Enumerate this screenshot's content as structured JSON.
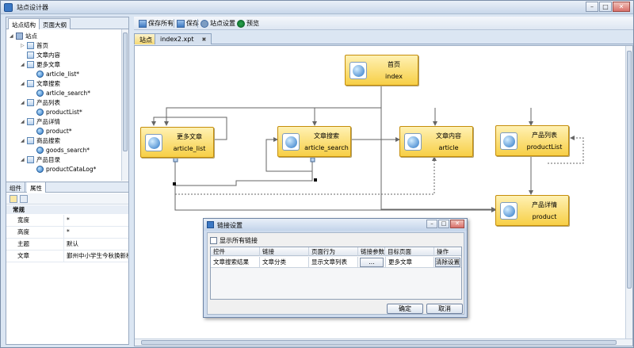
{
  "window": {
    "title": "站点设计器",
    "minimize": "–",
    "maximize": "□",
    "close": "✕"
  },
  "left_tabs": [
    "站点结构",
    "页面大纲"
  ],
  "tree": [
    {
      "label": "站点",
      "kind": "site",
      "toggle": "◢"
    },
    {
      "label": "首页",
      "kind": "folder",
      "toggle": "▷"
    },
    {
      "label": "文章内容",
      "kind": "folder",
      "toggle": ""
    },
    {
      "label": "更多文章",
      "kind": "folder",
      "toggle": "◢"
    },
    {
      "label": "article_list*",
      "kind": "page",
      "toggle": ""
    },
    {
      "label": "文章搜索",
      "kind": "folder",
      "toggle": "◢"
    },
    {
      "label": "article_search*",
      "kind": "page",
      "toggle": ""
    },
    {
      "label": "产品列表",
      "kind": "folder",
      "toggle": "◢"
    },
    {
      "label": "productList*",
      "kind": "page",
      "toggle": ""
    },
    {
      "label": "产品详情",
      "kind": "folder",
      "toggle": "◢"
    },
    {
      "label": "product*",
      "kind": "page",
      "toggle": ""
    },
    {
      "label": "商品搜索",
      "kind": "folder",
      "toggle": "◢"
    },
    {
      "label": "goods_search*",
      "kind": "page",
      "toggle": ""
    },
    {
      "label": "产品目录",
      "kind": "folder",
      "toggle": "◢"
    },
    {
      "label": "productCataLog*",
      "kind": "page",
      "toggle": ""
    }
  ],
  "prop_tabs": [
    "组件",
    "属性"
  ],
  "prop_group": "常规",
  "properties": [
    {
      "name": "宽度",
      "value": "*"
    },
    {
      "name": "高度",
      "value": "*"
    },
    {
      "name": "主题",
      "value": "默认"
    },
    {
      "name": "文章",
      "value": "鄞州中小学生今秋换新校服"
    }
  ],
  "toolbar": {
    "save_all": "保存所有",
    "save": "保存",
    "site_settings": "站点设置",
    "preview": "预览"
  },
  "doc_tabs": [
    {
      "label": "站点"
    },
    {
      "label": "index2.xpt",
      "close": "✖"
    }
  ],
  "nodes": [
    {
      "title": "首页",
      "name": "index"
    },
    {
      "title": "更多文章",
      "name": "article_list"
    },
    {
      "title": "文章搜索",
      "name": "article_search"
    },
    {
      "title": "文章内容",
      "name": "article"
    },
    {
      "title": "产品列表",
      "name": "productList"
    },
    {
      "title": "产品详情",
      "name": "product"
    }
  ],
  "dialog": {
    "title": "链接设置",
    "show_all": "显示所有链接",
    "columns": [
      "控件",
      "链接",
      "页面行为",
      "链接参数",
      "目标页面",
      "操作"
    ],
    "row": [
      "文章搜索结果",
      "文章分类",
      "显示文章列表",
      "...",
      "更多文章",
      "清除设置"
    ],
    "ok": "确定",
    "cancel": "取消"
  }
}
